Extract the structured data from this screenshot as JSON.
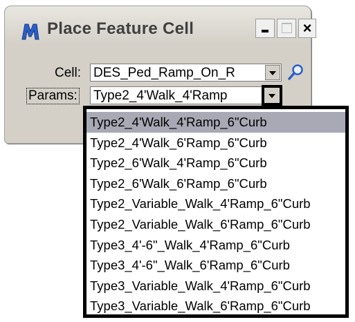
{
  "window": {
    "title": "Place Feature Cell",
    "app_icon": "microstation-m-icon",
    "minimize_glyph": "_",
    "close_glyph": "×"
  },
  "cell": {
    "label": "Cell:",
    "value": "DES_Ped_Ramp_On_R",
    "browse_icon": "magnifier-icon"
  },
  "params": {
    "label": "Params:",
    "value": "Type2_4'Walk_4'Ramp",
    "options": [
      "Type2_4'Walk_4'Ramp_6\"Curb",
      "Type2_4'Walk_6'Ramp_6\"Curb",
      "Type2_6'Walk_4'Ramp_6\"Curb",
      "Type2_6'Walk_6'Ramp_6\"Curb",
      "Type2_Variable_Walk_4'Ramp_6\"Curb",
      "Type2_Variable_Walk_6'Ramp_6\"Curb",
      "Type3_4'-6\"_Walk_4'Ramp_6\"Curb",
      "Type3_4'-6\"_Walk_6'Ramp_6\"Curb",
      "Type3_Variable_Walk_4'Ramp_6\"Curb",
      "Type3_Variable_Walk_6'Ramp_6\"Curb"
    ],
    "highlighted_index": 0
  },
  "colors": {
    "dialog_bg": "#d4d0c8",
    "title_text": "#3f3f3f",
    "highlight_bg": "#a9a9b5",
    "icon_blue": "#2b5fc7"
  }
}
